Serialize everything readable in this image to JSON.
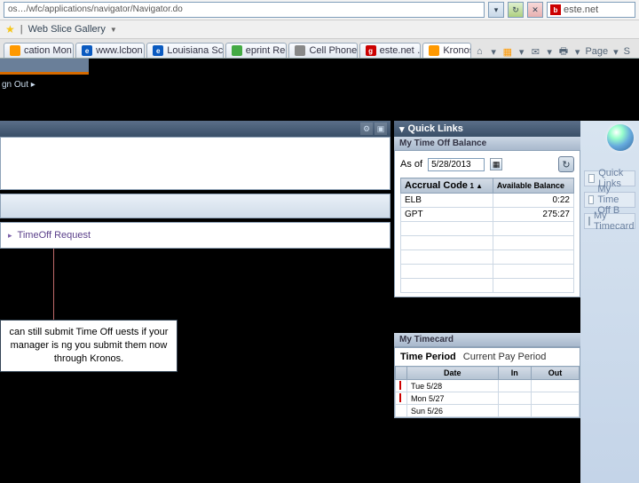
{
  "browser": {
    "address": "os…/wfc/applications/navigator/Navigator.do",
    "search_engine": "este.net",
    "favorites_label": "Web Slice Gallery",
    "tabs": [
      {
        "label": "cation Mon…",
        "icon": "orange"
      },
      {
        "label": "www.lcbon…",
        "icon": "blue-e"
      },
      {
        "label": "Louisiana Sc…",
        "icon": "blue-e"
      },
      {
        "label": "eprint   Regi",
        "icon": "green"
      },
      {
        "label": "Cell Phones,",
        "icon": "phone"
      },
      {
        "label": "este.net …",
        "icon": "g"
      },
      {
        "label": "Kronos",
        "icon": "orange"
      }
    ],
    "page_menu": "Page"
  },
  "app": {
    "signout": "gn Out  ▸",
    "left": {
      "link_label": "TimeOff Request",
      "callout": "can still submit Time Off uests if your manager is ng you submit them now through Kronos."
    },
    "quicklinks": {
      "title": "Quick Links",
      "balance": {
        "title": "My Time Off Balance",
        "as_of_label": "As of",
        "as_of_date": "5/28/2013",
        "col_accrual": "Accrual Code",
        "sort_indicator": "1 ▲",
        "col_balance": "Available Balance",
        "rows": [
          {
            "code": "ELB",
            "balance": "0:22"
          },
          {
            "code": "GPT",
            "balance": "275:27"
          }
        ]
      },
      "timecard": {
        "title": "My Timecard",
        "period_label": "Time Period",
        "period_value": "Current Pay Period",
        "col_date": "Date",
        "col_in": "In",
        "col_out": "Out",
        "rows": [
          {
            "date": "Tue 5/28"
          },
          {
            "date": "Mon 5/27"
          },
          {
            "date": "Sun 5/26"
          }
        ]
      }
    },
    "ghost_items": [
      "Quick Links",
      "My Time Off B",
      "My Timecard"
    ]
  }
}
